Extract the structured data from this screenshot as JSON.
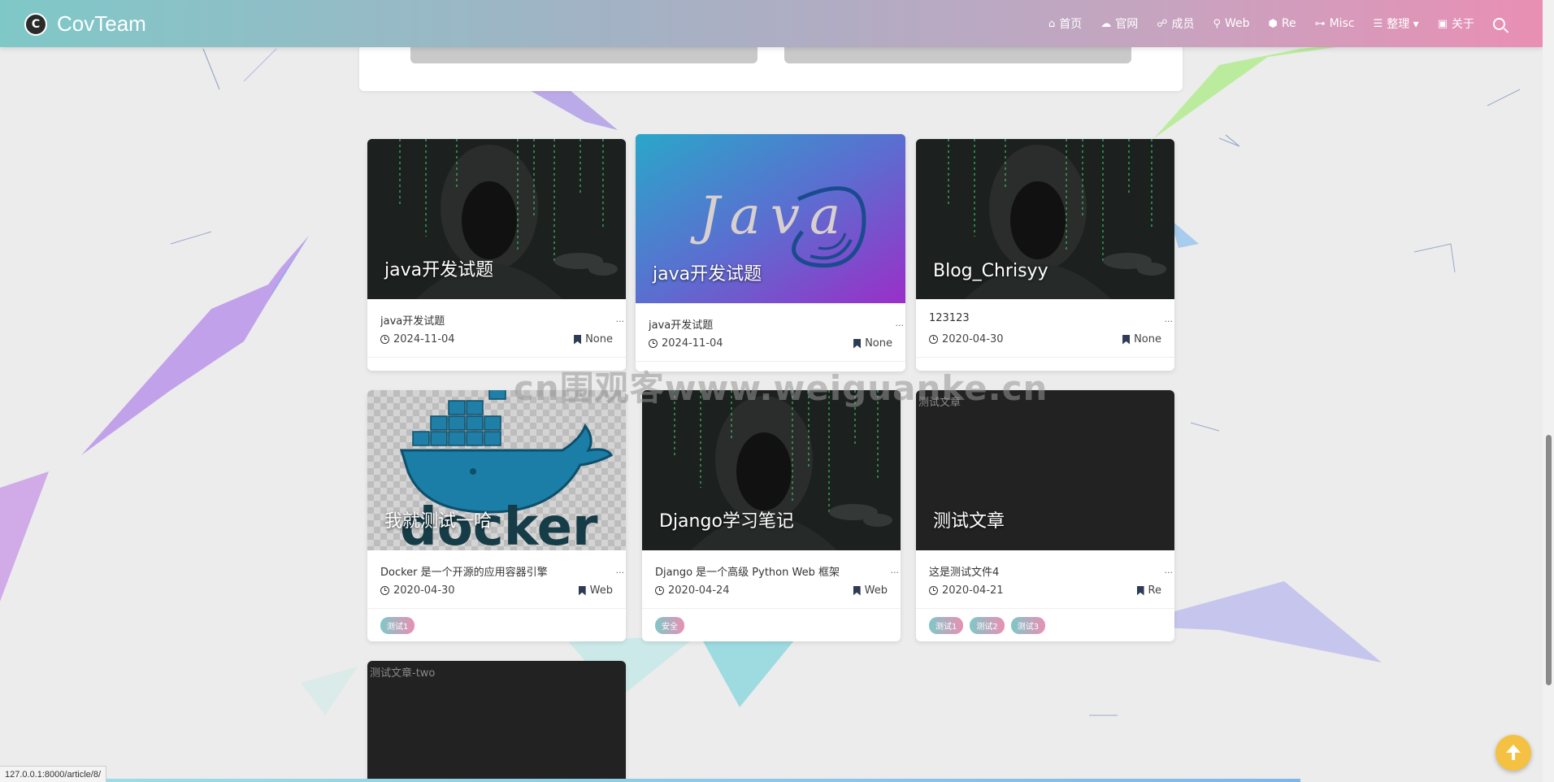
{
  "brand": {
    "name": "CovTeam",
    "logo_letter": "C"
  },
  "nav": {
    "items": [
      {
        "icon": "⌂",
        "icon_name": "home-icon",
        "label": "首页"
      },
      {
        "icon": "☁",
        "icon_name": "globe-icon",
        "label": "官网"
      },
      {
        "icon": "☍",
        "icon_name": "users-icon",
        "label": "成员"
      },
      {
        "icon": "⚲",
        "icon_name": "web-icon",
        "label": "Web"
      },
      {
        "icon": "⬢",
        "icon_name": "cube-icon",
        "label": "Re"
      },
      {
        "icon": "⊶",
        "icon_name": "gamepad-icon",
        "label": "Misc"
      },
      {
        "icon": "☰",
        "icon_name": "list-icon",
        "label": "整理 ▾"
      },
      {
        "icon": "▣",
        "icon_name": "info-icon",
        "label": "关于"
      }
    ]
  },
  "cards": [
    {
      "title": "java开发试题",
      "desc": "java开发试题",
      "date": "2024-11-04",
      "category": "None",
      "image": "hacker",
      "tags": []
    },
    {
      "title": "java开发试题",
      "desc": "java开发试题",
      "date": "2024-11-04",
      "category": "None",
      "image": "java",
      "tags": []
    },
    {
      "title": "Blog_Chrisyy",
      "desc": "123123",
      "date": "2020-04-30",
      "category": "None",
      "image": "hacker",
      "tags": []
    },
    {
      "title": "我就测试一哈",
      "desc": "Docker 是一个开源的应用容器引擎",
      "date": "2020-04-30",
      "category": "Web",
      "image": "docker",
      "tags": [
        "测试1"
      ]
    },
    {
      "title": "Django学习笔记",
      "desc": "Django 是一个高级 Python Web 框架",
      "date": "2020-04-24",
      "category": "Web",
      "image": "hacker",
      "tags": [
        "安全"
      ]
    },
    {
      "title": "测试文章",
      "alt": "测试文章",
      "desc": "这是测试文件4",
      "date": "2020-04-21",
      "category": "Re",
      "image": "broken",
      "tags": [
        "测试1",
        "测试2",
        "测试3"
      ]
    },
    {
      "title": "",
      "alt": "测试文章-two",
      "image": "broken"
    }
  ],
  "watermark": "cn围观客www.weiguanke.cn",
  "status_url": "127.0.0.1:8000/article/8/",
  "colors": {
    "nav_start": "#7fc8c8",
    "nav_end": "#e98fb4",
    "tag_start": "#7fc8c8",
    "tag_end": "#e98fb4",
    "to_top": "#f5c142"
  }
}
